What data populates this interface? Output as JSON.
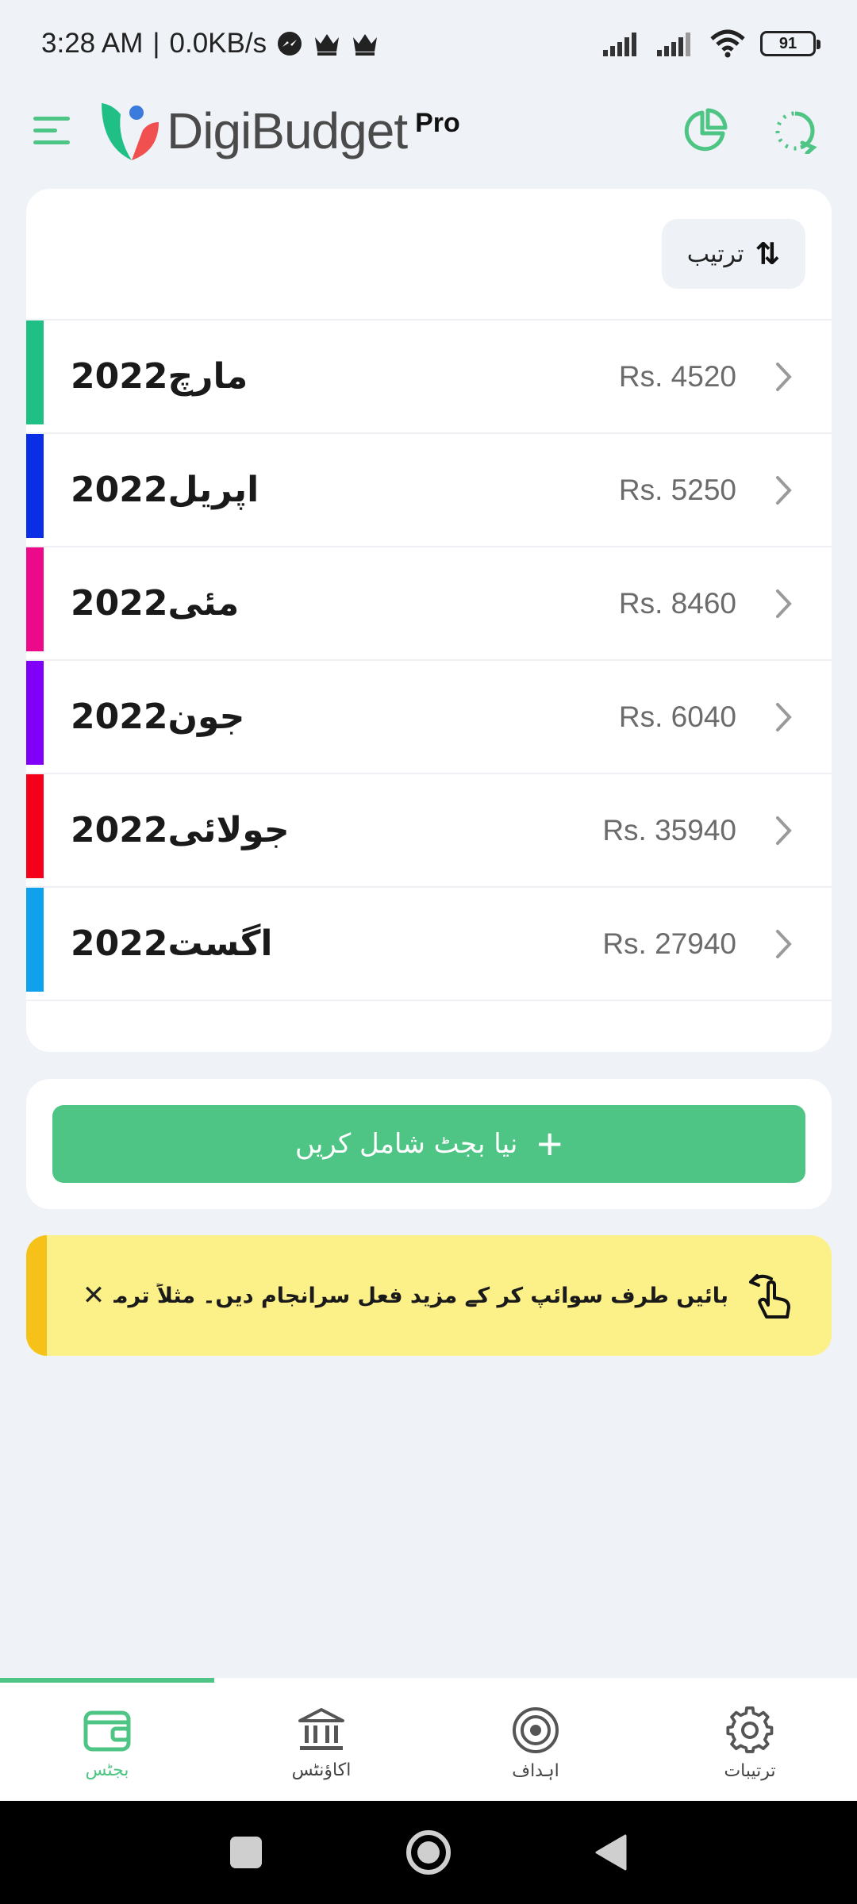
{
  "status_bar": {
    "time": "3:28 AM",
    "network_speed": "0.0KB/s",
    "battery": "91"
  },
  "header": {
    "app_name": "DigiBudget",
    "badge": "Pro"
  },
  "list": {
    "sort_label": "ترتیب",
    "items": [
      {
        "title": "مارچ2022",
        "amount": "Rs. 4520",
        "color": "#1fbf86"
      },
      {
        "title": "اپریل2022",
        "amount": "Rs. 5250",
        "color": "#0a2ee6"
      },
      {
        "title": "مئی2022",
        "amount": "Rs. 8460",
        "color": "#ec0a8a"
      },
      {
        "title": "جون2022",
        "amount": "Rs. 6040",
        "color": "#8000f7"
      },
      {
        "title": "جولائی2022",
        "amount": "Rs. 35940",
        "color": "#f5001a"
      },
      {
        "title": "اگست2022",
        "amount": "Rs. 27940",
        "color": "#0fa1ec"
      }
    ]
  },
  "add_budget": {
    "label": "نیا بجٹ شامل کریں"
  },
  "tip": {
    "text": "بائیں طرف سوائپ کر کے مزید فعل سرانجام دیں۔ مثلاً ترمیم کرنا، حذف کرنا، کاپی کرنا وغیرہ"
  },
  "bottom_nav": {
    "items": [
      {
        "label": "بجٹس",
        "icon": "wallet-icon",
        "active": true
      },
      {
        "label": "اکاؤنٹس",
        "icon": "bank-icon",
        "active": false
      },
      {
        "label": "اہداف",
        "icon": "target-icon",
        "active": false
      },
      {
        "label": "ترتیبات",
        "icon": "gear-icon",
        "active": false
      }
    ]
  },
  "colors": {
    "accent": "#4fc585",
    "tip_background": "#fcf089",
    "tip_accent": "#f6c21a",
    "background": "#eff2f7"
  }
}
